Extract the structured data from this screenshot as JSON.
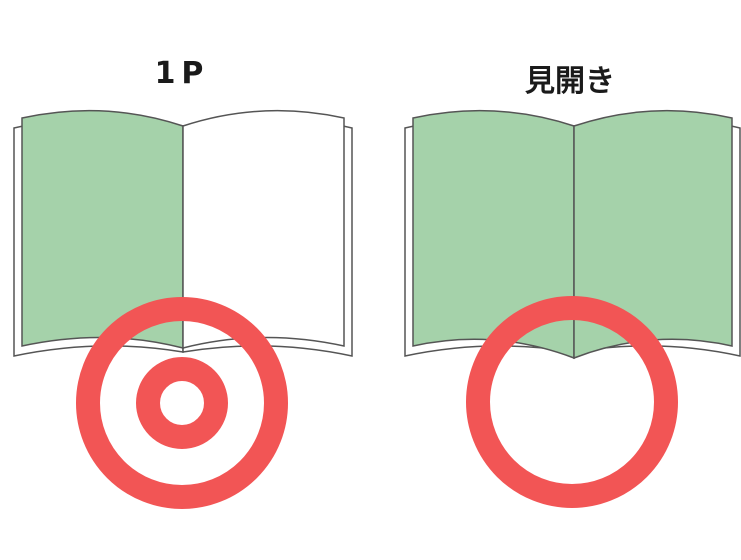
{
  "diagram": {
    "labels": {
      "single_page": "1P",
      "spread": "見開き"
    },
    "colors": {
      "page_green": "#a5d2aa",
      "page_white": "#ffffff",
      "outline": "#555555",
      "marker_red": "#f25555"
    },
    "books": [
      {
        "id": "single-page-book",
        "pages_colored": [
          "left"
        ],
        "marker": "double-circle"
      },
      {
        "id": "spread-book",
        "pages_colored": [
          "left",
          "right"
        ],
        "marker": "single-circle"
      }
    ]
  }
}
